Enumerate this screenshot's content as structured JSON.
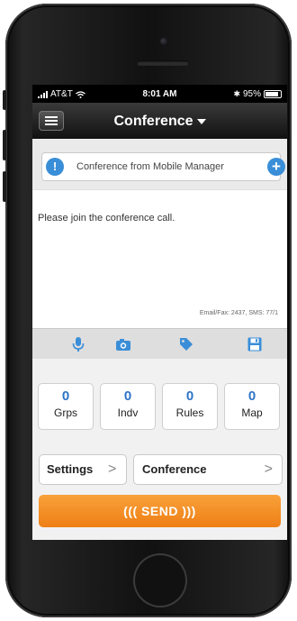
{
  "status_bar": {
    "carrier": "AT&T",
    "time": "8:01 AM",
    "battery": "95%"
  },
  "nav": {
    "title": "Conference"
  },
  "subject": {
    "info_icon": "!",
    "value": "Conference from Mobile Manager",
    "add_icon": "+"
  },
  "message": {
    "body": "Please join the conference call.",
    "counter": "Email/Fax: 2437, SMS: 77/1"
  },
  "toolbar": {
    "icons": [
      "microphone-icon",
      "camera-icon",
      "tag-icon",
      "save-icon"
    ]
  },
  "stats": [
    {
      "count": "0",
      "label": "Grps"
    },
    {
      "count": "0",
      "label": "Indv"
    },
    {
      "count": "0",
      "label": "Rules"
    },
    {
      "count": "0",
      "label": "Map"
    }
  ],
  "settings_button": {
    "label": "Settings",
    "chevron": ">"
  },
  "template_button": {
    "label": "Conference",
    "chevron": ">"
  },
  "send_button": {
    "label": "((( SEND )))"
  },
  "colors": {
    "accent_blue": "#3a8ed8",
    "send_orange": "#f28a22",
    "nav_dark": "#1e1e1e"
  }
}
